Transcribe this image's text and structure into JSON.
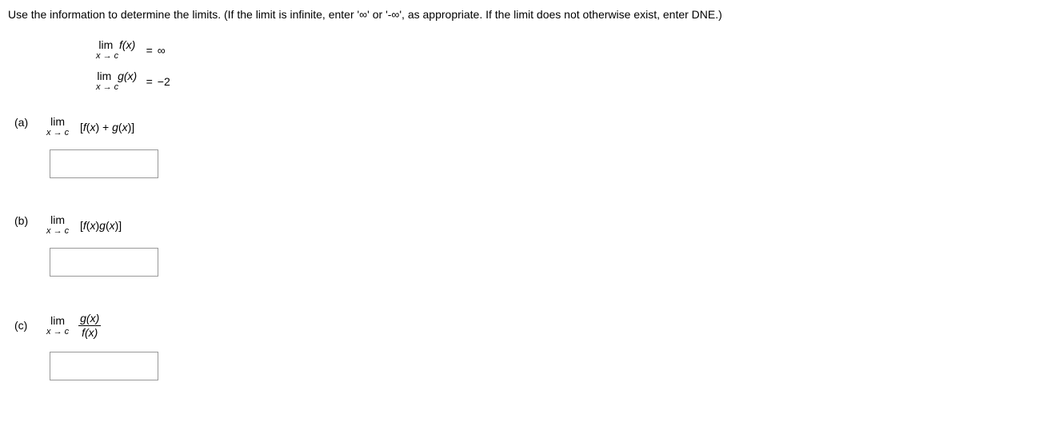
{
  "instructions": "Use the information to determine the limits. (If the limit is infinite, enter '∞' or '-∞', as appropriate. If the limit does not otherwise exist, enter DNE.)",
  "given": {
    "lim_label": "lim",
    "approach": "x → c",
    "f_expr": "f(x)",
    "f_equals": "=",
    "f_value": "∞",
    "g_expr": "g(x)",
    "g_equals": "=",
    "g_value": "−2"
  },
  "parts": {
    "a": {
      "label": "(a)",
      "lim_label": "lim",
      "approach": "x → c",
      "expr": "[f(x) + g(x)]",
      "answer": ""
    },
    "b": {
      "label": "(b)",
      "lim_label": "lim",
      "approach": "x → c",
      "expr": "[f(x)g(x)]",
      "answer": ""
    },
    "c": {
      "label": "(c)",
      "lim_label": "lim",
      "approach": "x → c",
      "frac_num": "g(x)",
      "frac_den": "f(x)",
      "answer": ""
    }
  }
}
